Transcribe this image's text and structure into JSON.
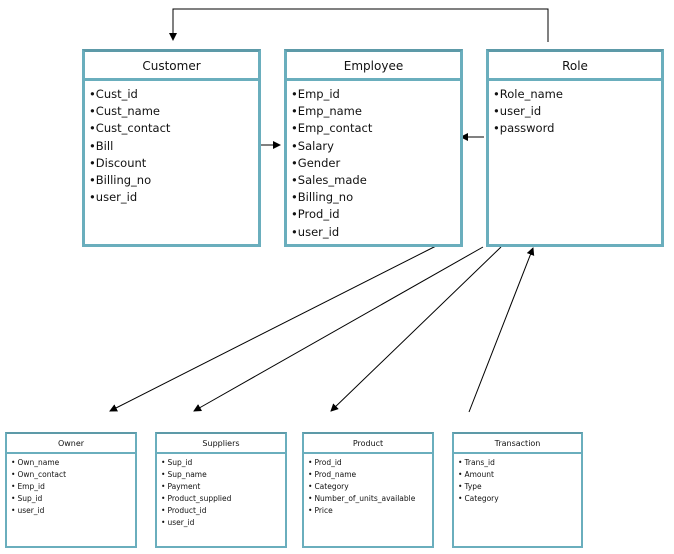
{
  "diagram": {
    "entities": [
      {
        "id": "customer",
        "title": "Customer",
        "fields": [
          "Cust_id",
          "Cust_name",
          "Cust_contact",
          "Bill",
          "Discount",
          "Billing_no",
          "user_id"
        ]
      },
      {
        "id": "employee",
        "title": "Employee",
        "fields": [
          "Emp_id",
          "Emp_name",
          "Emp_contact",
          "Salary",
          "Gender",
          "Sales_made",
          "Billing_no",
          "Prod_id",
          "user_id"
        ]
      },
      {
        "id": "role",
        "title": "Role",
        "fields": [
          "Role_name",
          "user_id",
          "password"
        ]
      },
      {
        "id": "owner",
        "title": "Owner",
        "fields": [
          "Own_name",
          "Own_contact",
          "Emp_id",
          "Sup_id",
          "user_id"
        ]
      },
      {
        "id": "suppliers",
        "title": "Suppliers",
        "fields": [
          "Sup_id",
          "Sup_name",
          "Payment",
          "Product_supplied",
          "Product_id",
          "user_id"
        ]
      },
      {
        "id": "product",
        "title": "Product",
        "fields": [
          "Prod_id",
          "Prod_name",
          "Category",
          "Number_of_units_available",
          "Price"
        ]
      },
      {
        "id": "transaction",
        "title": "Transaction",
        "fields": [
          "Trans_id",
          "Amount",
          "Type",
          "Category"
        ]
      }
    ],
    "relationships": [
      {
        "from": "role",
        "to": "customer"
      },
      {
        "from": "customer",
        "to": "employee"
      },
      {
        "from": "role",
        "to": "employee"
      },
      {
        "from": "employee",
        "to": "owner"
      },
      {
        "from": "role",
        "to": "suppliers"
      },
      {
        "from": "role",
        "to": "product"
      },
      {
        "from": "transaction",
        "to": "role"
      }
    ],
    "colors": {
      "border": "#6aaebd",
      "line": "#000000"
    }
  }
}
